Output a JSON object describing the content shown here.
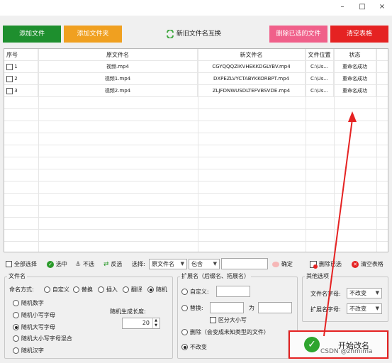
{
  "window": {
    "minimize": "–",
    "maximize": "□",
    "close": "×"
  },
  "toolbar": {
    "add_file": "添加文件",
    "add_folder": "添加文件夹",
    "swap_names": "新旧文件名互换",
    "delete_selected_file": "删除已选的文件",
    "clear_table": "清空表格",
    "colors": {
      "green": "#1e8f2e",
      "orange": "#f0a020",
      "pink": "#f0608a",
      "red": "#e52222"
    }
  },
  "table": {
    "headers": [
      "序号",
      "原文件名",
      "新文件名",
      "文件位置",
      "状态"
    ],
    "rows": [
      {
        "index": "1",
        "old": "视频.mp4",
        "new": "CGYQQQZIKVHEKKDGLYBV.mp4",
        "location": "C:\\Us...",
        "status": "重命名成功"
      },
      {
        "index": "2",
        "old": "视频1.mp4",
        "new": "DXPEZLVYCTABYKKORBPT.mp4",
        "location": "C:\\Us...",
        "status": "重命名成功"
      },
      {
        "index": "3",
        "old": "视频2.mp4",
        "new": "ZLJFDNWUSDLTEFVBSVDE.mp4",
        "location": "C:\\Us...",
        "status": "重命名成功"
      }
    ]
  },
  "selection_bar": {
    "select_all": "全部选择",
    "select": "选中",
    "unselect": "不选",
    "invert": "反选",
    "select_label": "选择:",
    "field_value": "原文件名",
    "match_value": "包含",
    "filter_value": "",
    "confirm": "确定",
    "delete_selected": "删除已选",
    "clear_table": "清空表格"
  },
  "filename_group": {
    "title": "文件名",
    "mode_label": "命名方式:",
    "modes": [
      "自定义",
      "替换",
      "插入",
      "翻译",
      "随机"
    ],
    "selected_mode": "随机",
    "random_options": [
      "随机数字",
      "随机小写字母",
      "随机大写字母",
      "随机大小写字母混合",
      "随机汉字"
    ],
    "selected_random": "随机大写字母",
    "length_label": "随机生成长度:",
    "length_value": "20"
  },
  "ext_group": {
    "title": "扩展名（后缀名、拓展名）",
    "custom": "自定义:",
    "replace": "替换:",
    "to_label": "为",
    "case_sensitive": "区分大小写",
    "delete_option": "删除（会变成未知类型的文件）",
    "no_change": "不改变",
    "selected": "不改变"
  },
  "other_group": {
    "title": "其他选项",
    "filename_case_label": "文件名字母:",
    "filename_case_value": "不改变",
    "ext_case_label": "扩展名字母:",
    "ext_case_value": "不改变"
  },
  "start_button": "开始改名",
  "watermark": "CSDN @zhmima",
  "annotation_color": "#e52222"
}
